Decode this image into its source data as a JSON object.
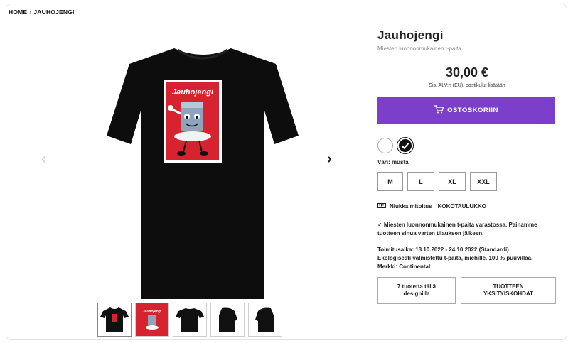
{
  "breadcrumb": {
    "home": "HOME",
    "separator": "›",
    "current": "JAUHOJENGI"
  },
  "product": {
    "title": "Jauhojengi",
    "subtitle": "Miesten luonnonmukainen t-paita",
    "price": "30,00 €",
    "vat_note": "Sis. ALV:n (EU), postikulut lisätään",
    "print_text": "Jauhojengi"
  },
  "cart": {
    "label": "OSTOSKORIIN",
    "icon": "shopping-cart-icon"
  },
  "colors": {
    "options": [
      "white",
      "black"
    ],
    "selected": "black",
    "label": "Väri: musta",
    "white_hex": "#ffffff",
    "black_hex": "#111111"
  },
  "sizes": [
    "M",
    "L",
    "XL",
    "XXL"
  ],
  "fit": {
    "text": "Niukka mitoitus",
    "link": "KOKOTAULUKKO",
    "icon": "ruler-icon"
  },
  "description": "✓ Miesten luonnonmukainen t-paita varastossa. Painamme tuotteen sinua varten tilauksen jälkeen.",
  "delivery": {
    "line1": "Toimitusaika: 18.10.2022 - 24.10.2022 (Standardi)",
    "line2": "Ekologisesti valmistettu t-paita, miehille. 100 % puuvillaa.",
    "line3": "Merkki: Continental"
  },
  "buttons": {
    "related": "7 tuotetta tällä designilla",
    "details": "TUOTTEEN YKSITYISKOHDAT"
  },
  "theme": {
    "accent": "#7b3fc9",
    "print_red": "#d6232f"
  }
}
